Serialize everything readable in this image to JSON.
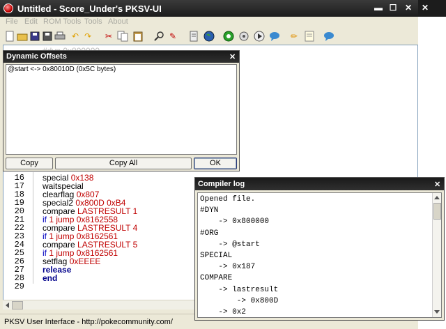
{
  "window": {
    "title": "Untitled - Score_Under's PKSV-UI",
    "minimize": "▬",
    "maximize": "☐",
    "close": "✕"
  },
  "menu": [
    "File",
    "Edit",
    "ROM Tools",
    "Tools",
    "About"
  ],
  "toolbar_icons": [
    "new-file-icon",
    "open-icon",
    "save-icon",
    "save-as-icon",
    "print-icon",
    "undo-icon",
    "redo-icon",
    "cut-icon",
    "copy-icon",
    "paste-icon",
    "find-icon",
    "replace-icon",
    "decompile-icon",
    "globe-icon",
    "compile-icon",
    "settings-icon",
    "run-icon",
    "chat-icon",
    "pencil-icon",
    "notes-icon",
    "help-icon"
  ],
  "editor": {
    "partial_top_line": "#dyn  0x800000",
    "lines": [
      {
        "num": "16",
        "kw": "special",
        "arg": "0x138"
      },
      {
        "num": "17",
        "kw": "waitspecial",
        "arg": ""
      },
      {
        "num": "18",
        "kw": "clearflag",
        "arg": "0x807"
      },
      {
        "num": "19",
        "kw": "special2",
        "arg": "0x800D 0xB4"
      },
      {
        "num": "20",
        "kw": "compare",
        "arg": "LASTRESULT 1"
      },
      {
        "num": "21",
        "kw": "if",
        "arg": "1 jump 0x8162558"
      },
      {
        "num": "22",
        "kw": "compare",
        "arg": "LASTRESULT 4"
      },
      {
        "num": "23",
        "kw": "if",
        "arg": "1 jump 0x8162561"
      },
      {
        "num": "24",
        "kw": "compare",
        "arg": "LASTRESULT 5"
      },
      {
        "num": "25",
        "kw": "if",
        "arg": "1 jump 0x8162561"
      },
      {
        "num": "26",
        "kw": "setflag",
        "arg": "0xEEEE"
      },
      {
        "num": "27",
        "kw": "release",
        "arg": ""
      },
      {
        "num": "28",
        "kw": "end",
        "arg": ""
      },
      {
        "num": "29",
        "kw": "",
        "arg": ""
      }
    ]
  },
  "dynamic_offsets": {
    "title": "Dynamic Offsets",
    "close": "✕",
    "items": [
      "@start <-> 0x80010D (0x5C bytes)"
    ],
    "buttons": {
      "copy": "Copy",
      "copy_all": "Copy All",
      "ok": "OK"
    }
  },
  "compiler_log": {
    "title": "Compiler log",
    "close": "✕",
    "lines": [
      "Opened file.",
      "#DYN",
      "    -> 0x800000",
      "#ORG",
      "    -> @start",
      "SPECIAL",
      "    -> 0x187",
      "COMPARE",
      "    -> lastresult",
      "        -> 0x800D",
      "    -> 0x2"
    ]
  },
  "status": {
    "text": "PKSV User Interface - http://pokecommunity.com/"
  },
  "background_window": {
    "close": "✕"
  },
  "colors": {
    "titlebar": "#1c1c1c",
    "argument": "#c00000",
    "keyword_blue": "#0000c0",
    "keyword_bold": "#00008b"
  }
}
